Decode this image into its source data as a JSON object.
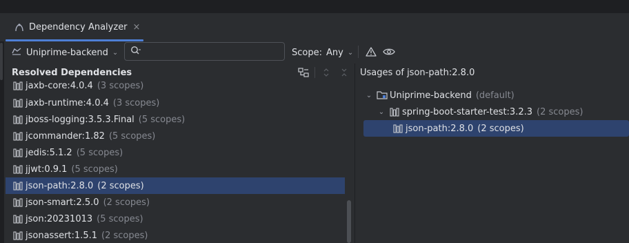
{
  "tab": {
    "label": "Dependency Analyzer",
    "close": "×"
  },
  "toolbar": {
    "module": "Uniprime-backend",
    "search_placeholder": "",
    "scope_label": "Scope:",
    "scope_value": "Any"
  },
  "left": {
    "title": "Resolved Dependencies",
    "items": [
      {
        "name": "jaxb-core:4.0.4",
        "scope": "(3 scopes)"
      },
      {
        "name": "jaxb-runtime:4.0.4",
        "scope": "(3 scopes)"
      },
      {
        "name": "jboss-logging:3.5.3.Final",
        "scope": "(5 scopes)"
      },
      {
        "name": "jcommander:1.82",
        "scope": "(5 scopes)"
      },
      {
        "name": "jedis:5.1.2",
        "scope": "(5 scopes)"
      },
      {
        "name": "jjwt:0.9.1",
        "scope": "(5 scopes)"
      },
      {
        "name": "json-path:2.8.0",
        "scope": "(2 scopes)",
        "selected": true
      },
      {
        "name": "json-smart:2.5.0",
        "scope": "(2 scopes)"
      },
      {
        "name": "json:20231013",
        "scope": "(5 scopes)"
      },
      {
        "name": "jsonassert:1.5.1",
        "scope": "(2 scopes)"
      }
    ]
  },
  "right": {
    "title": "Usages of json-path:2.8.0",
    "tree": [
      {
        "name": "Uniprime-backend",
        "scope": "(default)",
        "kind": "module"
      },
      {
        "name": "spring-boot-starter-test:3.2.3",
        "scope": "(2 scopes)",
        "kind": "library"
      },
      {
        "name": "json-path:2.8.0",
        "scope": "(2 scopes)",
        "kind": "library",
        "selected": true
      }
    ]
  },
  "colors": {
    "accent": "#4e7fd6",
    "selection": "#2e436e",
    "background": "#2b2d30",
    "muted": "#868991"
  }
}
